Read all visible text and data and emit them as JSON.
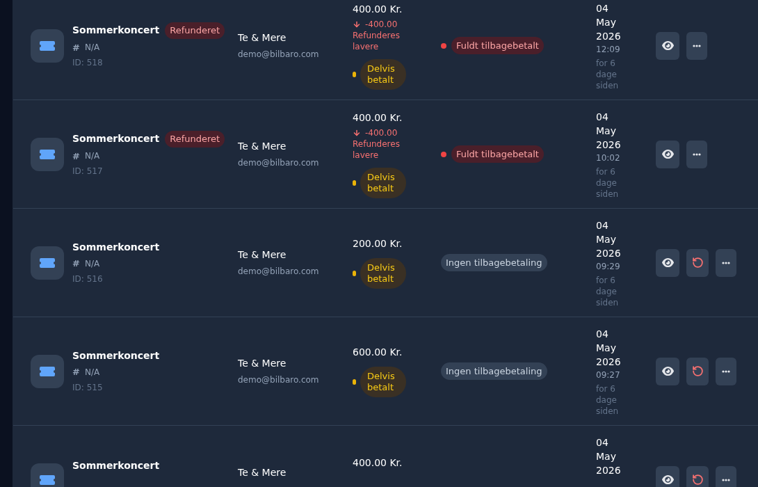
{
  "orders": [
    {
      "event": "Sommerkoncert",
      "badge": "Refunderet",
      "number_prefix": "#",
      "number": "N/A",
      "id": "ID: 518",
      "customer": "Te & Mere",
      "email": "demo@bilbaro.com",
      "amount": "400.00 Kr.",
      "refund": {
        "amount": "-400.00",
        "label": "Refunderes lavere"
      },
      "payment": {
        "label": "Delvis betalt",
        "color": "#eab308"
      },
      "refund_status": {
        "kind": "full",
        "label": "Fuldt tilbagebetalt"
      },
      "date": "04 May 2026",
      "time": "12:09",
      "ago": "for 6 dage siden",
      "actions": [
        {
          "kind": "view"
        },
        {
          "kind": "more"
        }
      ]
    },
    {
      "event": "Sommerkoncert",
      "badge": "Refunderet",
      "number_prefix": "#",
      "number": "N/A",
      "id": "ID: 517",
      "customer": "Te & Mere",
      "email": "demo@bilbaro.com",
      "amount": "400.00 Kr.",
      "refund": {
        "amount": "-400.00",
        "label": "Refunderes lavere"
      },
      "payment": {
        "label": "Delvis betalt",
        "color": "#eab308"
      },
      "refund_status": {
        "kind": "full",
        "label": "Fuldt tilbagebetalt"
      },
      "date": "04 May 2026",
      "time": "10:02",
      "ago": "for 6 dage siden",
      "actions": [
        {
          "kind": "view"
        },
        {
          "kind": "more"
        }
      ]
    },
    {
      "event": "Sommerkoncert",
      "number_prefix": "#",
      "number": "N/A",
      "id": "ID: 516",
      "customer": "Te & Mere",
      "email": "demo@bilbaro.com",
      "amount": "200.00 Kr.",
      "payment": {
        "label": "Delvis betalt",
        "color": "#eab308"
      },
      "refund_status": {
        "kind": "none",
        "label": "Ingen tilbagebetaling"
      },
      "date": "04 May 2026",
      "time": "09:29",
      "ago": "for 6 dage siden",
      "actions": [
        {
          "kind": "view"
        },
        {
          "kind": "refund"
        },
        {
          "kind": "more"
        }
      ]
    },
    {
      "event": "Sommerkoncert",
      "number_prefix": "#",
      "number": "N/A",
      "id": "ID: 515",
      "customer": "Te & Mere",
      "email": "demo@bilbaro.com",
      "amount": "600.00 Kr.",
      "payment": {
        "label": "Delvis betalt",
        "color": "#eab308"
      },
      "refund_status": {
        "kind": "none",
        "label": "Ingen tilbagebetaling"
      },
      "date": "04 May 2026",
      "time": "09:27",
      "ago": "for 6 dage siden",
      "actions": [
        {
          "kind": "view"
        },
        {
          "kind": "refund"
        },
        {
          "kind": "more"
        }
      ]
    },
    {
      "event": "Sommerkoncert",
      "customer": "Te & Mere",
      "amount": "400.00 Kr.",
      "date": "04 May 2026",
      "actions": [
        {
          "kind": "view"
        },
        {
          "kind": "refund"
        },
        {
          "kind": "more"
        }
      ]
    }
  ]
}
